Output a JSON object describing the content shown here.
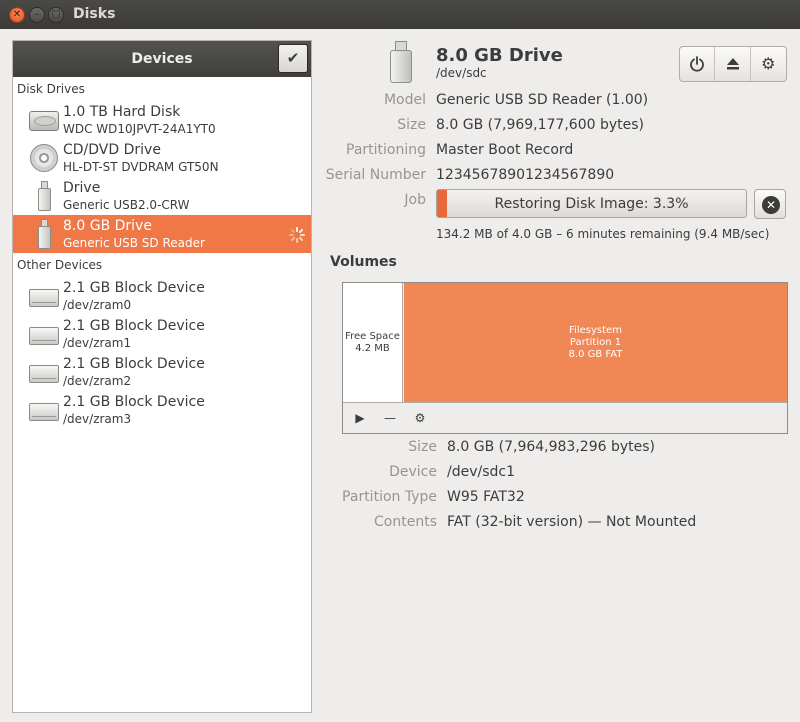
{
  "window": {
    "title": "Disks"
  },
  "sidebar": {
    "header": "Devices",
    "sections": {
      "disk_drives": "Disk Drives",
      "other_devices": "Other Devices"
    },
    "disk_drives": [
      {
        "name": "1.0 TB Hard Disk",
        "sub": "WDC WD10JPVT-24A1YT0",
        "icon": "hard-disk-icon"
      },
      {
        "name": "CD/DVD Drive",
        "sub": "HL-DT-ST DVDRAM GT50N",
        "icon": "optical-drive-icon"
      },
      {
        "name": "Drive",
        "sub": "Generic USB2.0-CRW",
        "icon": "usb-drive-icon"
      },
      {
        "name": "8.0 GB Drive",
        "sub": "Generic USB  SD Reader",
        "icon": "usb-drive-icon",
        "selected": true
      }
    ],
    "other_devices": [
      {
        "name": "2.1 GB Block Device",
        "sub": "/dev/zram0",
        "icon": "block-device-icon"
      },
      {
        "name": "2.1 GB Block Device",
        "sub": "/dev/zram1",
        "icon": "block-device-icon"
      },
      {
        "name": "2.1 GB Block Device",
        "sub": "/dev/zram2",
        "icon": "block-device-icon"
      },
      {
        "name": "2.1 GB Block Device",
        "sub": "/dev/zram3",
        "icon": "block-device-icon"
      }
    ]
  },
  "drive": {
    "title": "8.0 GB Drive",
    "path": "/dev/sdc",
    "labels": {
      "model": "Model",
      "size": "Size",
      "partitioning": "Partitioning",
      "serial": "Serial Number",
      "job": "Job"
    },
    "values": {
      "model": "Generic USB  SD Reader (1.00)",
      "size": "8.0 GB (7,969,177,600 bytes)",
      "partitioning": "Master Boot Record",
      "serial": "12345678901234567890"
    },
    "job": {
      "text": "Restoring Disk Image: 3.3%",
      "progress_percent": 3.3,
      "status": "134.2 MB of 4.0 GB – 6 minutes remaining (9.4 MB/sec)"
    }
  },
  "volumes": {
    "title": "Volumes",
    "free": {
      "line1": "Free Space",
      "line2": "4.2 MB"
    },
    "partition": {
      "line1": "Filesystem",
      "line2": "Partition 1",
      "line3": "8.0 GB FAT"
    },
    "labels": {
      "size": "Size",
      "device": "Device",
      "partition_type": "Partition Type",
      "contents": "Contents"
    },
    "values": {
      "size": "8.0 GB (7,964,983,296 bytes)",
      "device": "/dev/sdc1",
      "partition_type": "W95 FAT32",
      "contents": "FAT (32-bit version) — Not Mounted"
    }
  },
  "colors": {
    "accent": "#f07746",
    "partition": "#f08755",
    "progress": "#e8673b"
  }
}
